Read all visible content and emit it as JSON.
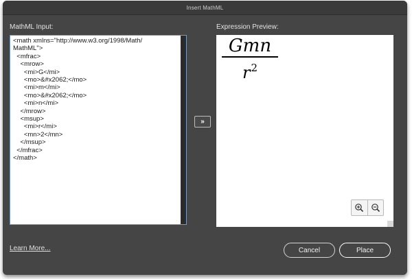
{
  "window": {
    "title": "Insert MathML"
  },
  "input": {
    "label": "MathML Input:",
    "code": "<math xmlns=\"http://www.w3.org/1998/Math/\nMathML\">\n  <mfrac>\n    <mrow>\n      <mi>G</mi>\n      <mo>&#x2062;</mo>\n      <mi>m</mi>\n      <mo>&#x2062;</mo>\n      <mi>n</mi>\n    </mrow>\n    <msup>\n      <mi>r</mi>\n      <mn>2</mn>\n    </msup>\n  </mfrac>\n</math>"
  },
  "convert": {
    "label": "»",
    "icon": "double-chevron-right-icon"
  },
  "preview": {
    "label": "Expression Preview:",
    "numerator": "Gmn",
    "denominator_base": "r",
    "denominator_exponent": "2",
    "zoom_in_icon": "zoom-in-icon",
    "zoom_out_icon": "zoom-out-icon"
  },
  "footer": {
    "learn_more": "Learn More...",
    "cancel": "Cancel",
    "place": "Place"
  },
  "colors": {
    "dialog_bg": "#454545",
    "input_border": "#5da3ea"
  }
}
